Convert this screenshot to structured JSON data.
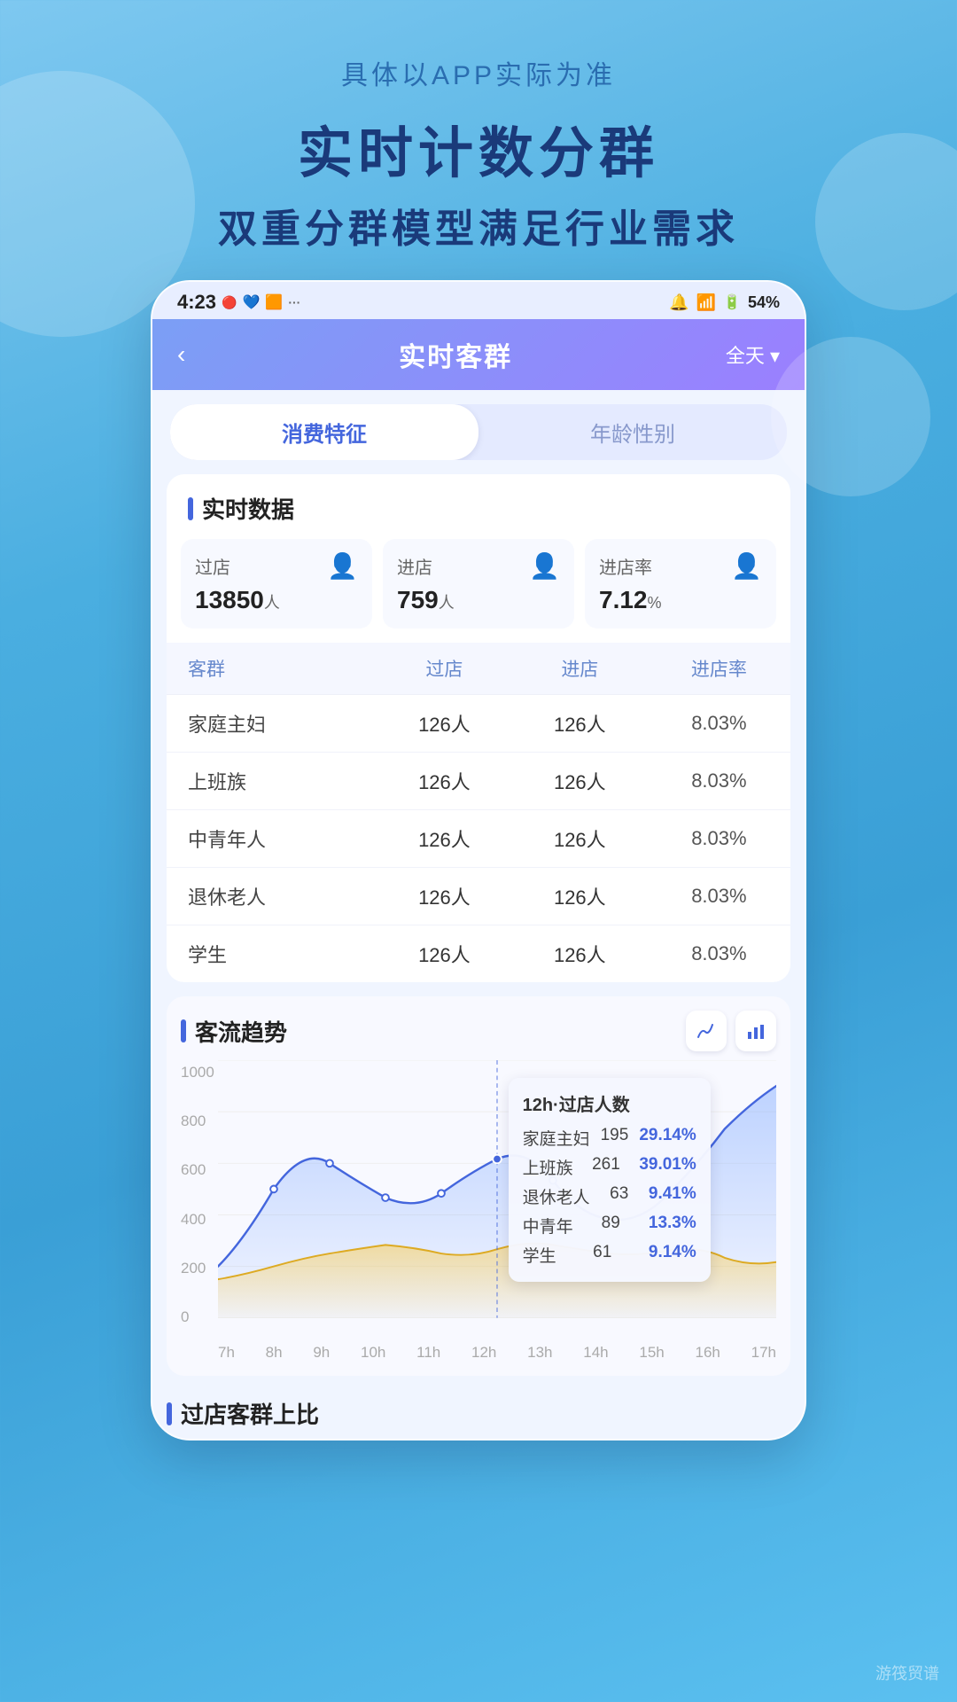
{
  "background": {
    "subtitle": "具体以APP实际为准",
    "title": "实时计数分群",
    "desc": "双重分群模型满足行业需求"
  },
  "statusBar": {
    "time": "4:23",
    "battery": "54%"
  },
  "navBar": {
    "back": "‹",
    "title": "实时客群",
    "filter": "全天 ▾"
  },
  "tabs": [
    {
      "id": "consume",
      "label": "消费特征",
      "active": true
    },
    {
      "id": "age",
      "label": "年龄性别",
      "active": false
    }
  ],
  "realtime": {
    "sectionTitle": "实时数据",
    "cards": [
      {
        "label": "过店",
        "value": "13850",
        "unit": "人",
        "icon": "👤",
        "iconColor": "#6699ff"
      },
      {
        "label": "进店",
        "value": "759",
        "unit": "人",
        "icon": "👤",
        "iconColor": "#ff6699"
      },
      {
        "label": "进店率",
        "value": "7.12",
        "unit": "%",
        "icon": "👤",
        "iconColor": "#ffaa33"
      }
    ]
  },
  "table": {
    "headers": [
      "客群",
      "过店",
      "进店",
      "进店率"
    ],
    "rows": [
      {
        "name": "家庭主妇",
        "pass": "126人",
        "enter": "126人",
        "rate": "8.03%"
      },
      {
        "name": "上班族",
        "pass": "126人",
        "enter": "126人",
        "rate": "8.03%"
      },
      {
        "name": "中青年人",
        "pass": "126人",
        "enter": "126人",
        "rate": "8.03%"
      },
      {
        "name": "退休老人",
        "pass": "126人",
        "enter": "126人",
        "rate": "8.03%"
      },
      {
        "name": "学生",
        "pass": "126人",
        "enter": "126人",
        "rate": "8.03%"
      }
    ]
  },
  "chart": {
    "sectionTitle": "客流趋势",
    "yLabels": [
      "1000",
      "800",
      "600",
      "400",
      "200",
      "0"
    ],
    "xLabels": [
      "7h",
      "8h",
      "9h",
      "10h",
      "11h",
      "12h",
      "13h",
      "14h",
      "15h",
      "16h",
      "17h"
    ],
    "tooltip": {
      "title": "12h·过店人数",
      "rows": [
        {
          "name": "家庭主妇",
          "count": "195",
          "pct": "29.14%"
        },
        {
          "name": "上班族",
          "count": "261",
          "pct": "39.01%"
        },
        {
          "name": "退休老人",
          "count": "63",
          "pct": "9.41%"
        },
        {
          "name": "中青年",
          "count": "89",
          "pct": "13.3%"
        },
        {
          "name": "学生",
          "count": "61",
          "pct": "9.14%"
        }
      ]
    }
  },
  "bottomSection": {
    "title": "过店客群上比"
  },
  "watermark": "游筏贸谱"
}
